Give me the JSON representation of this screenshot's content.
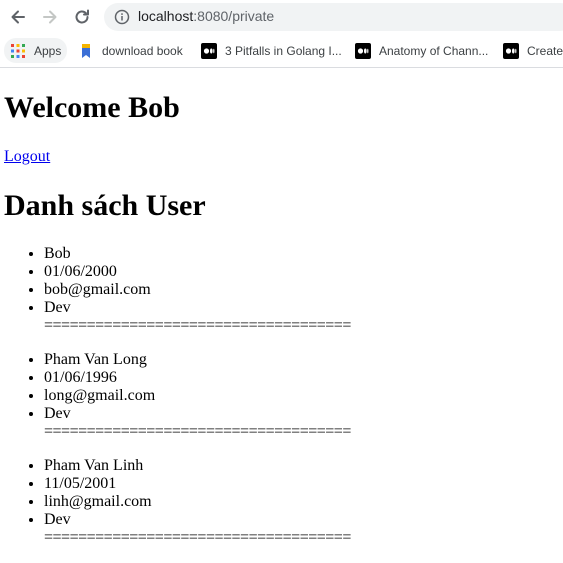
{
  "browser": {
    "url_host": "localhost",
    "url_path": ":8080/private",
    "bookmarks": [
      {
        "label": "Apps"
      },
      {
        "label": "download book"
      },
      {
        "label": "3 Pitfalls in Golang I..."
      },
      {
        "label": "Anatomy of Chann..."
      },
      {
        "label": "Create"
      }
    ]
  },
  "page": {
    "welcome": "Welcome Bob",
    "logout_label": "Logout",
    "list_title": "Danh sách User",
    "users": [
      {
        "name": "Bob",
        "dob": "01/06/2000",
        "email": "bob@gmail.com",
        "role": "Dev"
      },
      {
        "name": "Pham Van Long",
        "dob": "01/06/1996",
        "email": "long@gmail.com",
        "role": "Dev"
      },
      {
        "name": "Pham Van Linh",
        "dob": "11/05/2001",
        "email": "linh@gmail.com",
        "role": "Dev"
      }
    ],
    "separator": "===================================="
  }
}
